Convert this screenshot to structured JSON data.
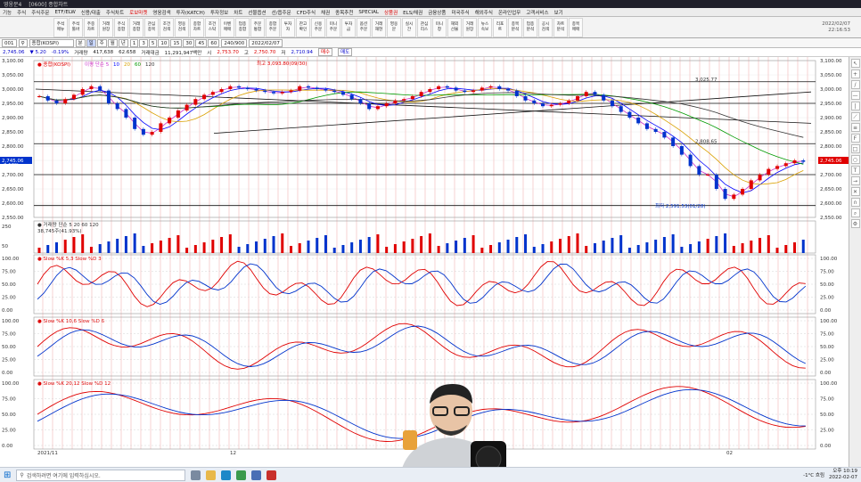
{
  "titlebar": {
    "app": "영웅문4",
    "items": [
      "종합차트",
      "[0600] 종합차트"
    ],
    "right": "KRX"
  },
  "menu": [
    "기능",
    "주식",
    "주식주문",
    "ETF/ELW",
    "신용/대출",
    "주식차트",
    "로보마켓",
    "영웅검색",
    "투자(KATCH)",
    "투자정보",
    "차트",
    "선물옵션",
    "선/옵주문",
    "CFD주식",
    "채권",
    "종목추천",
    "SPECIAL",
    "상품권",
    "ELS/채권",
    "금융상품",
    "미국주식",
    "해외주식",
    "온라인업무",
    "고객서비스",
    "보기"
  ],
  "menu_hot": [
    "로보마켓",
    "상품권"
  ],
  "toolbar_buttons": [
    "주석\n메뉴",
    "주석\n툴바",
    "주중\n차트",
    "거래\n원장",
    "주식\n종합",
    "거래\n종합",
    "관심\n종목",
    "조건\n검색",
    "영웅\n검색",
    "종합\n차트",
    "조건\n스탁",
    "이벤\n매매",
    "업종\n종합",
    "주문\n통합",
    "종합\n주문",
    "투자\n자",
    "잔고\n확인",
    "신용\n주문",
    "미니\n주문",
    "투자\n금",
    "옵션\n주문",
    "거래\n재현",
    "영웅\n문",
    "실시\n간",
    "관심\n리스",
    "미니\n창",
    "해외\n선물",
    "거래\n원장",
    "뉴스\n속보",
    "리포\n트",
    "종목\n분석",
    "업종\n분석",
    "공시\n검색",
    "차트\n분석",
    "종목\n매매"
  ],
  "toolbar_right": {
    "date": "2022/02/07",
    "time": "22:16:53"
  },
  "options": {
    "code": "001",
    "name": "종합(KOSPI)",
    "periods": [
      "분",
      "일",
      "주",
      "월",
      "년"
    ],
    "selected_period": "일",
    "minutes": [
      "1",
      "3",
      "5",
      "10",
      "15",
      "30",
      "45",
      "60"
    ],
    "count": "240/900",
    "date": "2022/02/07"
  },
  "quote": {
    "price": "2,745.06",
    "change": "▼ 5.20",
    "pct": "-0.19%",
    "label": "거래량",
    "volume": "417,638",
    "vol2": "62.658",
    "trade_amt": "거래대금",
    "amount": "11,291,947백만",
    "open_label": "시",
    "open": "2,753.70",
    "high_label": "고",
    "high": "2,750.70",
    "low_label": "저",
    "low": "2,710.94",
    "buy": "매수",
    "sell": "매도"
  },
  "chart_data": [
    {
      "type": "line",
      "title": "종합(KOSPI)",
      "legend": [
        "이평 단순 5",
        "10",
        "20",
        "60",
        "120"
      ],
      "ylim": [
        2550,
        3100
      ],
      "yticks": [
        "3,100.00",
        "3,050.00",
        "3,000.00",
        "2,950.00",
        "2,900.00",
        "2,850.00",
        "2,800.00",
        "2,750.00",
        "2,700.00",
        "2,650.00",
        "2,600.00",
        "2,550.00"
      ],
      "annotations": [
        "최고 3,093.80(09/30)",
        "3,025.77",
        "2,808.65",
        "최저 2,591.53(01/28)"
      ],
      "current": "2,745.06",
      "current_pct": "-0.19%",
      "xlabels": [
        "2021/11",
        "12",
        "02"
      ],
      "series": [
        {
          "name": "종가",
          "values": [
            2975,
            2960,
            2950,
            2965,
            2980,
            3000,
            3010,
            2995,
            2950,
            2930,
            2900,
            2860,
            2840,
            2850,
            2880,
            2900,
            2925,
            2945,
            2965,
            2980,
            2990,
            3000,
            3010,
            3005,
            3000,
            2995,
            2990,
            2985,
            2990,
            2995,
            3010,
            3005,
            3000,
            2995,
            2990,
            2980,
            2965,
            2950,
            2930,
            2940,
            2950,
            2960,
            2965,
            2975,
            2990,
            3000,
            3010,
            3005,
            2995,
            2990,
            2995,
            3005,
            3010,
            3000,
            2995,
            2975,
            2960,
            2950,
            2940,
            2945,
            2950,
            2960,
            2975,
            2990,
            2980,
            2960,
            2940,
            2920,
            2900,
            2880,
            2860,
            2850,
            2830,
            2800,
            2770,
            2730,
            2700,
            2700,
            2650,
            2615,
            2630,
            2650,
            2680,
            2700,
            2720,
            2730,
            2740,
            2750,
            2745
          ]
        }
      ]
    },
    {
      "type": "bar",
      "title": "거래량",
      "legend": [
        "단순 5",
        "20",
        "60",
        "120"
      ],
      "value": "38,745주(41.93%)",
      "ylim": [
        0,
        250
      ],
      "yticks": [
        "250",
        "50"
      ]
    },
    {
      "type": "line",
      "title": "Slow %K 5,3",
      "legend": [
        "Slow %K 5,3",
        "Slow %D 3"
      ],
      "ylim": [
        0,
        100
      ],
      "yticks": [
        "100.00",
        "75.00",
        "50.00",
        "25.00",
        "0.00"
      ]
    },
    {
      "type": "line",
      "title": "Slow %K 10,6",
      "legend": [
        "Slow %K 10,6",
        "Slow %D 6"
      ],
      "ylim": [
        0,
        100
      ],
      "yticks": [
        "100.00",
        "75.00",
        "50.00",
        "25.00",
        "0.00"
      ]
    },
    {
      "type": "line",
      "title": "Slow %K 20,12",
      "legend": [
        "Slow %K 20,12",
        "Slow %D 12"
      ],
      "ylim": [
        0,
        100
      ],
      "yticks": [
        "100.00",
        "75.00",
        "50.00",
        "25.00",
        "0.00"
      ]
    }
  ],
  "right_icons": [
    "cursor-icon",
    "crosshair-icon",
    "line-icon",
    "hline-icon",
    "vline-icon",
    "trend-icon",
    "channel-icon",
    "fib-icon",
    "rect-icon",
    "circle-icon",
    "text-icon",
    "arrow-icon",
    "delete-icon",
    "magnet-icon",
    "zoom-icon",
    "settings-icon"
  ],
  "taskbar": {
    "search": "검색하려면 여기에 입력하십시오.",
    "weather": "-1°C 흐림",
    "time": "오후 10:19",
    "date": "2022-02-07"
  },
  "colors": {
    "up": "#e00000",
    "down": "#0033cc",
    "ma5": "#cc33cc",
    "ma10": "#0000ff",
    "ma20": "#d9a000",
    "ma60": "#009900",
    "ma120": "#333333"
  }
}
